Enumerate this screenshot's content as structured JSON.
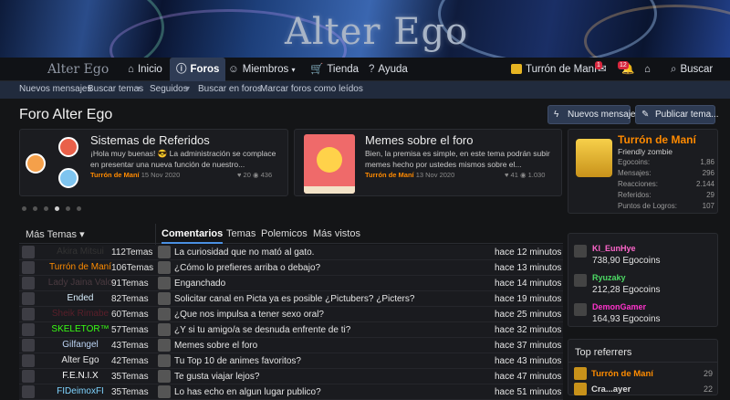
{
  "banner": {
    "logo": "Alter Ego"
  },
  "nav": {
    "logo": "Alter Ego",
    "items": [
      {
        "label": "Inicio",
        "icon": "⌂"
      },
      {
        "label": "Foros",
        "icon": "ⓘ"
      },
      {
        "label": "Miembros",
        "icon": "☺"
      },
      {
        "label": "Tienda",
        "icon": "🛒"
      },
      {
        "label": "Ayuda",
        "icon": "?"
      }
    ],
    "user": "Turrón de Maní",
    "messages_badge": "1",
    "alerts_badge": "12",
    "search_label": "Buscar"
  },
  "subnav": [
    "Nuevos mensajes",
    "Buscar temas",
    "Seguidos",
    "Buscar en foros",
    "Marcar foros como leídos"
  ],
  "page": {
    "title": "Foro Alter Ego",
    "btn_new": "Nuevos mensajes",
    "btn_post": "Publicar tema..."
  },
  "cards": [
    {
      "title": "Sistemas de Referidos",
      "text": "¡Hola muy buenas! 😎 La administración se complace en presentar una nueva función de nuestro...",
      "user": "Turrón de Maní",
      "date": "15 Nov 2020",
      "reactions": "20",
      "views": "436"
    },
    {
      "title": "Memes sobre el foro",
      "text": "Bien, la premisa es simple, en este tema podrán subir memes hecho por ustedes mismos sobre el...",
      "user": "Turrón de Maní",
      "date": "13 Nov 2020",
      "reactions": "41",
      "views": "1.030"
    }
  ],
  "profile": {
    "name": "Turrón de Maní",
    "subtitle": "Friendly zombie",
    "stats": [
      {
        "label": "Egocoins:",
        "value": "1,86"
      },
      {
        "label": "Mensajes:",
        "value": "296"
      },
      {
        "label": "Reacciones:",
        "value": "2.144"
      },
      {
        "label": "Referidos:",
        "value": "29"
      },
      {
        "label": "Puntos de Logros:",
        "value": "107"
      }
    ]
  },
  "tabs": {
    "more": "Más Temas ▾",
    "items": [
      "Comentarios",
      "Temas",
      "Polemicos",
      "Más vistos"
    ]
  },
  "rows": [
    {
      "name": "Akira Mitsui",
      "color": "#333333",
      "count": "112Temas",
      "topic": "La curiosidad que no mató al gato.",
      "time": "hace 12 minutos"
    },
    {
      "name": "Turrón de Maní",
      "color": "#ff8c00",
      "count": "106Temas",
      "topic": "¿Cómo lo prefieres arriba o debajo?",
      "time": "hace 13 minutos"
    },
    {
      "name": "Lady Jaina Valo",
      "color": "#4a3a40",
      "count": "91Temas",
      "topic": "Enganchado",
      "time": "hace 14 minutos"
    },
    {
      "name": "Ended",
      "color": "#d9f0ff",
      "count": "82Temas",
      "topic": "Solicitar canal en Picta ya es posible ¿Pictubers? ¿Picters?",
      "time": "hace 19 minutos"
    },
    {
      "name": "Sheik Rimabe",
      "color": "#5a1f2a",
      "count": "60Temas",
      "topic": "¿Que nos impulsa a tener sexo oral?",
      "time": "hace 25 minutos"
    },
    {
      "name": "SKELETOR™",
      "color": "#39ff14",
      "count": "57Temas",
      "topic": "¿Y si tu amigo/a se desnuda enfrente de ti?",
      "time": "hace 32 minutos"
    },
    {
      "name": "Gilfangel",
      "color": "#bcd4f5",
      "count": "43Temas",
      "topic": "Memes sobre el foro",
      "time": "hace 37 minutos"
    },
    {
      "name": "Alter Ego",
      "color": "#e8e8e8",
      "count": "42Temas",
      "topic": "Tu Top 10 de animes favoritos?",
      "time": "hace 43 minutos"
    },
    {
      "name": "F.E.N.I.X",
      "color": "#ffffff",
      "count": "35Temas",
      "topic": "Te gusta viajar lejos?",
      "time": "hace 47 minutos"
    },
    {
      "name": "FIDeimoxFI",
      "color": "#7fd4ff",
      "count": "35Temas",
      "topic": "Lo has echo en algun lugar publico?",
      "time": "hace 51 minutos"
    }
  ],
  "richest": [
    {
      "name": "Kl_EunHye",
      "color": "#ff66cc",
      "coins": "738,90 Egocoins"
    },
    {
      "name": "Ryuzaky",
      "color": "#4cd964",
      "coins": "212,28 Egocoins"
    },
    {
      "name": "DemonGamer",
      "color": "#ff33cc",
      "coins": "164,93 Egocoins"
    }
  ],
  "referrers": {
    "title": "Top referrers",
    "items": [
      {
        "name": "Turrón de Maní",
        "color": "#ff8c00",
        "count": "29"
      },
      {
        "name": "Cra...ayer",
        "color": "#dddddd",
        "count": "22"
      }
    ]
  }
}
